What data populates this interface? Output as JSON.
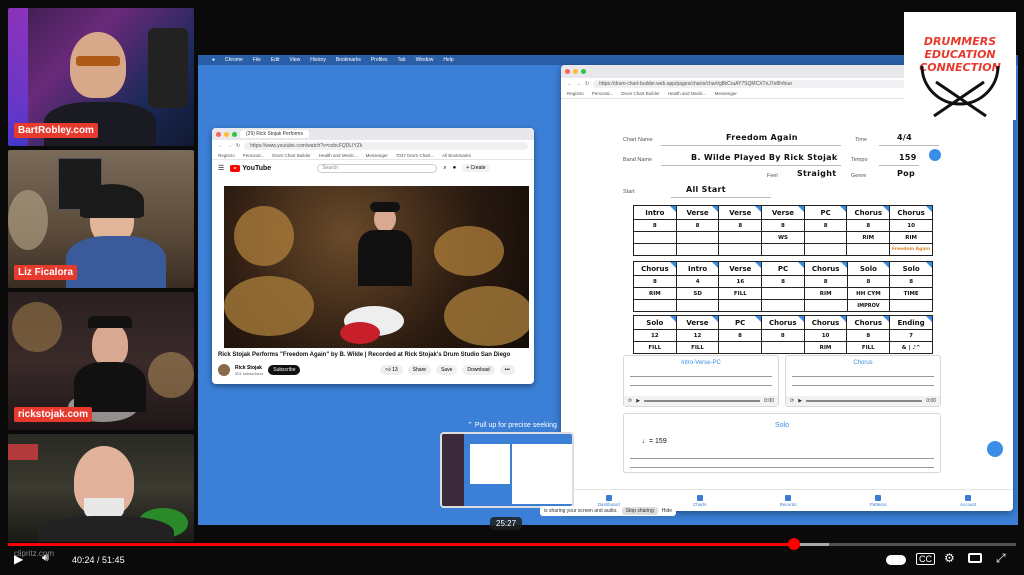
{
  "participants": [
    {
      "label": "BartRobley.com"
    },
    {
      "label": "Liz Ficalora"
    },
    {
      "label": "rickstojak.com"
    },
    {
      "label": ""
    }
  ],
  "menubar": [
    "Chrome",
    "File",
    "Edit",
    "View",
    "History",
    "Bookmarks",
    "Profiles",
    "Tab",
    "Window",
    "Help"
  ],
  "yt_window": {
    "tab_title": "(29) Rick Stojak Performs",
    "url": "https://www.youtube.com/watch?v=cxbcFQDLIYZk",
    "bookmarks": [
      "Registro",
      "Personal...",
      "Drum Chart Builder",
      "Health and Medic...",
      "Messenger",
      "7037 Drum Chart...",
      "All Bookmarks"
    ],
    "logo_text": "YouTube",
    "search_placeholder": "Search",
    "create_label": "+ Create",
    "video_title": "Rick Stojak Performs \"Freedom Again\" by B. Wilde | Recorded at Rick Stojak's Drum Studio San Diego",
    "channel": "Rick Stojak",
    "subscribers": "301 subscribers",
    "subscribe_label": "Subscribe",
    "likes": "13",
    "share_label": "Share",
    "save_label": "Save",
    "download_label": "Download",
    "more_label": "•••"
  },
  "dc_window": {
    "url": "https://drum-chart-builder.web.app/pages/charts/chart/g8kCruAY7SQMCXTnJ7e8h/true",
    "chart_name_label": "Chart Name",
    "chart_name": "Freedom Again",
    "band_name_label": "Band Name",
    "band_name": "B. Wilde Played By Rick Stojak",
    "time_label": "Time",
    "time_value": "4/4",
    "tempo_label": "Tempo",
    "tempo_value": "159",
    "feel_label": "Feel",
    "feel_value": "Straight",
    "genre_label": "Genre",
    "genre_value": "Pop",
    "start_label": "Start",
    "start_value": "All Start",
    "rows": [
      {
        "sections": [
          "Intro",
          "Verse",
          "Verse",
          "Verse",
          "PC",
          "Chorus",
          "Chorus"
        ],
        "bars": [
          "8",
          "8",
          "8",
          "8",
          "8",
          "8",
          "10"
        ],
        "notes": [
          "",
          "",
          "",
          "WS",
          "",
          "RIM",
          "RIM"
        ],
        "extra": [
          "",
          "",
          "",
          "",
          "",
          "",
          "Freedom Again"
        ]
      },
      {
        "sections": [
          "Chorus",
          "Intro",
          "Verse",
          "PC",
          "Chorus",
          "Solo",
          "Solo"
        ],
        "bars": [
          "8",
          "4",
          "16",
          "8",
          "8",
          "8",
          "8"
        ],
        "notes": [
          "RIM",
          "SD",
          "FILL",
          "",
          "RIM",
          "HH CYM",
          "TIME"
        ],
        "extra": [
          "",
          "",
          "",
          "",
          "",
          "IMPROV",
          ""
        ]
      },
      {
        "sections": [
          "Solo",
          "Verse",
          "PC",
          "Chorus",
          "Chorus",
          "Chorus",
          "Ending"
        ],
        "bars": [
          "12",
          "12",
          "8",
          "8",
          "10",
          "8",
          "7"
        ],
        "notes": [
          "FILL",
          "FILL",
          "",
          "",
          "RIM",
          "FILL",
          "& | ♪^"
        ],
        "extra": [
          "",
          "",
          "",
          "",
          "",
          "",
          ""
        ]
      }
    ],
    "notation_a": "Intro-Verse-PC",
    "notation_b": "Chorus",
    "notation_c": "Solo",
    "tempo_mark": "♩= 159",
    "player_time_a": "0:00",
    "player_time_b": "0:00",
    "nav": [
      "Dashboard",
      "Charts",
      "Records",
      "Patterns",
      "Account"
    ]
  },
  "thumbnail": {
    "seek_hint": "Pull up for precise seeking",
    "share_text": "is sharing your screen and audio.",
    "stop_label": "Stop sharing",
    "hide_label": "Hide"
  },
  "logo": {
    "line1": "DRUMMERS",
    "line2": "EDUCATION",
    "line3": "CONNECTION"
  },
  "player": {
    "seek_time": "25:27",
    "current": "40:24",
    "duration": "51:45",
    "progress_fraction": 0.78,
    "buffered_fraction": 0.814,
    "watermark": "clipritz.com"
  },
  "colors": {
    "accent_red": "#e63a2e",
    "youtube_red": "#ff0000",
    "screen_blue": "#3b7fd6",
    "chart_blue": "#3a8ee6"
  }
}
